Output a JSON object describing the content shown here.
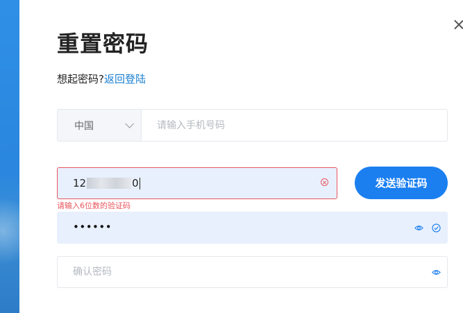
{
  "page": {
    "title": "重置密码",
    "subtitle_prefix": "想起密码?",
    "back_to_login": "返回登陆"
  },
  "phone": {
    "country": "中国",
    "placeholder": "请输入手机号码"
  },
  "code": {
    "value_prefix": "12",
    "value_suffix": "0",
    "error": "请输入6位数的验证码"
  },
  "send_button": "发送验证码",
  "password": {
    "masked_value": "••••••"
  },
  "confirm_password": {
    "placeholder": "确认密码"
  },
  "colors": {
    "accent": "#1b7ff0",
    "error": "#e8555c",
    "filled_bg": "#e8f0fd"
  },
  "icons": [
    "close-icon",
    "chevron-down-icon",
    "clear-icon",
    "eye-icon",
    "check-circle-icon"
  ]
}
